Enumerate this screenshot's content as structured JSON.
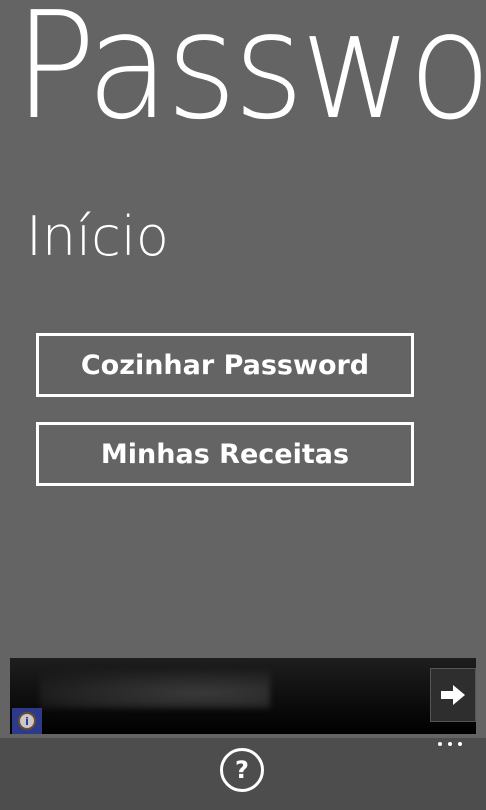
{
  "app": {
    "title": "Passwo",
    "page_title": "Início"
  },
  "buttons": {
    "cook_password": "Cozinhar Password",
    "my_recipes": "Minhas Receitas"
  },
  "ad_banner": {
    "info_icon": "info-icon",
    "arrow_icon": "arrow-right-icon"
  },
  "app_bar": {
    "help_symbol": "?",
    "help_icon": "question-icon",
    "more_icon": "ellipsis-icon"
  },
  "colors": {
    "background": "#646464",
    "app_bar": "#4d4d4d",
    "foreground": "#ffffff"
  }
}
